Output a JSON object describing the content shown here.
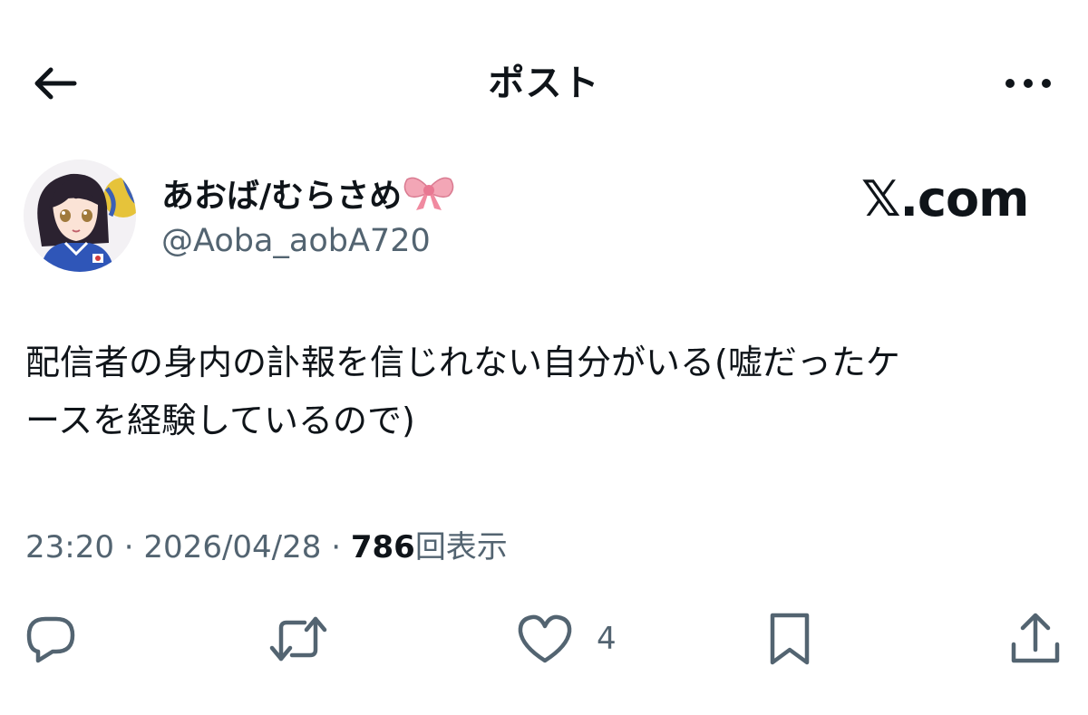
{
  "header": {
    "title": "ポスト",
    "back_icon": "arrow-left-icon",
    "more_icon": "more-horizontal-icon"
  },
  "author": {
    "display_name": "あおば/むらさめ",
    "handle": "@Aoba_aobA720",
    "badge_emoji": "ribbon-bow-icon",
    "avatar": "anime-avatar"
  },
  "watermark": {
    "text": "𝕏.com"
  },
  "post": {
    "text_line1": "配信者の身内の訃報を信じれない自分がいる(嘘だったケ",
    "text_line2": "ースを経験しているので)"
  },
  "meta": {
    "time": "23:20",
    "separator": " · ",
    "date": "2026/04/28",
    "views_count": "786",
    "views_label": "回表示"
  },
  "actions": {
    "reply_icon": "reply-icon",
    "repost_icon": "repost-icon",
    "like_icon": "heart-icon",
    "like_count": "4",
    "bookmark_icon": "bookmark-icon",
    "share_icon": "share-icon"
  },
  "colors": {
    "text": "#0f1419",
    "secondary": "#536471",
    "background": "#ffffff"
  }
}
